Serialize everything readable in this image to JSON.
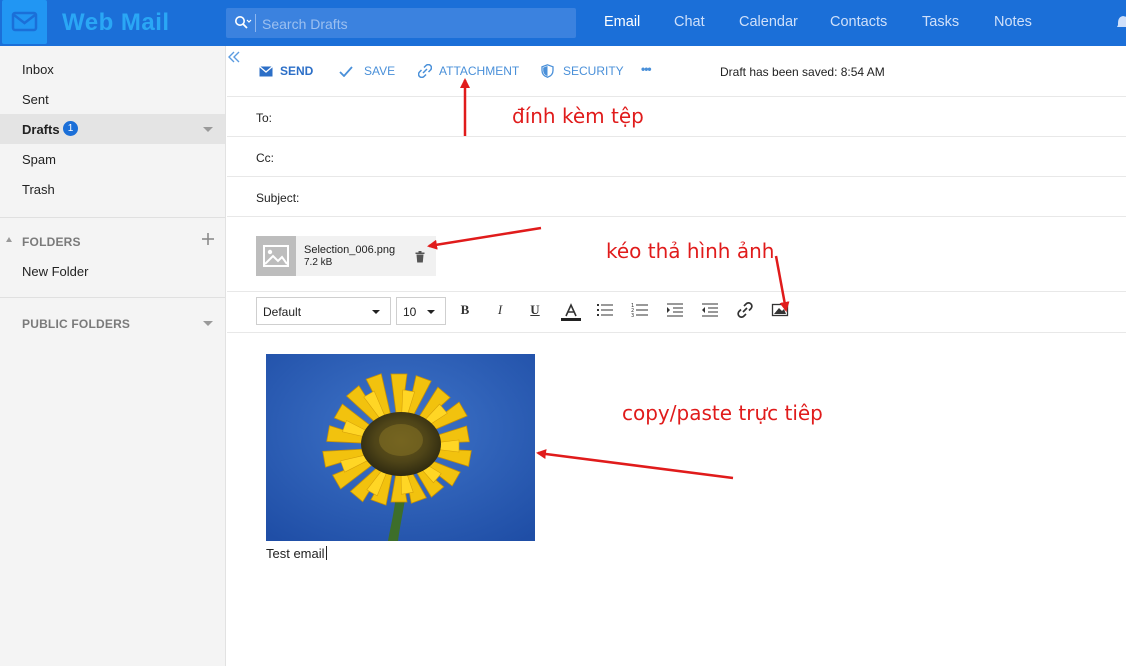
{
  "app": {
    "title": "Web Mail"
  },
  "search": {
    "placeholder": "Search Drafts"
  },
  "nav": {
    "email": "Email",
    "chat": "Chat",
    "calendar": "Calendar",
    "contacts": "Contacts",
    "tasks": "Tasks",
    "notes": "Notes"
  },
  "sidebar": {
    "items": [
      {
        "label": "Inbox"
      },
      {
        "label": "Sent"
      },
      {
        "label": "Drafts",
        "badge": "1"
      },
      {
        "label": "Spam"
      },
      {
        "label": "Trash"
      }
    ],
    "folders_header": "FOLDERS",
    "new_folder": "New Folder",
    "public_folders": "PUBLIC FOLDERS"
  },
  "toolbar": {
    "send": "SEND",
    "save": "SAVE",
    "attachment": "ATTACHMENT",
    "security": "SECURITY",
    "more": "•••",
    "status": "Draft has been saved: 8:54 AM"
  },
  "fields": {
    "to": "To:",
    "cc": "Cc:",
    "subject": "Subject:"
  },
  "attachment": {
    "name": "Selection_006.png",
    "size": "7.2 kB"
  },
  "editor": {
    "font": "Default",
    "size": "10"
  },
  "body": {
    "text": "Test email"
  },
  "annotations": {
    "attach": "đính kèm tệp",
    "drag": "kéo thả hình ảnh",
    "paste": "copy/paste trực tiêp"
  },
  "colors": {
    "topbar": "#1b6fd8",
    "accent": "#4a90d9",
    "annotation": "#e01b1b"
  }
}
